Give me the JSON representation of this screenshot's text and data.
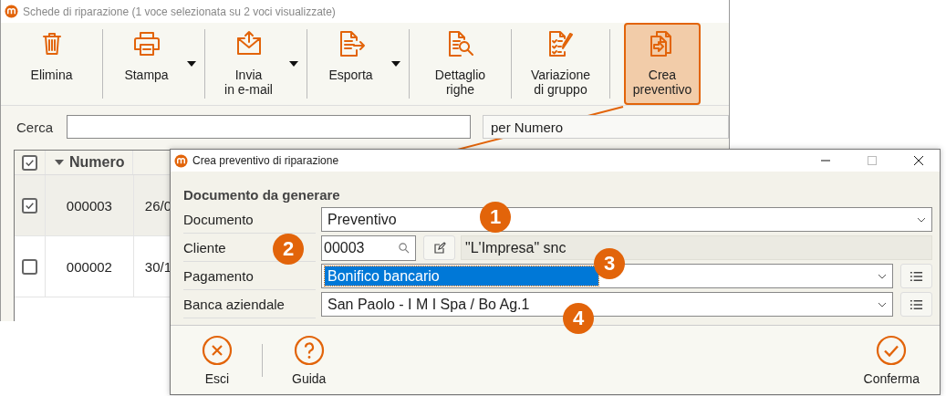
{
  "main_window": {
    "title": "Schede di riparazione (1 voce selezionata su 2 voci visualizzate)",
    "toolbar": [
      {
        "kind": "trash",
        "label": "Elimina",
        "dropdown": false,
        "selected": false
      },
      {
        "kind": "printer",
        "label": "Stampa",
        "dropdown": true,
        "selected": false
      },
      {
        "kind": "mail",
        "label": "Invia\nin e-mail",
        "dropdown": true,
        "selected": false
      },
      {
        "kind": "export",
        "label": "Esporta",
        "dropdown": true,
        "selected": false
      },
      {
        "kind": "detail",
        "label": "Dettaglio\nrighe",
        "dropdown": false,
        "selected": false
      },
      {
        "kind": "checklist",
        "label": "Variazione\ndi gruppo",
        "dropdown": false,
        "selected": false
      },
      {
        "kind": "copy",
        "label": "Crea\npreventivo",
        "dropdown": false,
        "selected": true
      }
    ],
    "search": {
      "label": "Cerca"
    },
    "sort_select": "per Numero",
    "table": {
      "header_checked": true,
      "columns": [
        "Numero"
      ],
      "rows": [
        {
          "checked": true,
          "selected": true,
          "cells": [
            "000003",
            "26/0"
          ]
        },
        {
          "checked": false,
          "selected": false,
          "cells": [
            "000002",
            "30/1"
          ]
        }
      ]
    }
  },
  "dialog": {
    "title": "Crea preventivo di riparazione",
    "section": "Documento da generare",
    "fields": [
      {
        "kind": "select",
        "label": "Documento",
        "value": "Preventivo",
        "selected": false,
        "list_button": false
      },
      {
        "kind": "lookup",
        "label": "Cliente",
        "value": "00003",
        "description": "\"L'Impresa\" snc"
      },
      {
        "kind": "select",
        "label": "Pagamento",
        "value": "Bonifico bancario",
        "selected": true,
        "list_button": true
      },
      {
        "kind": "select",
        "label": "Banca aziendale",
        "value": "San Paolo - I M I Spa / Bo Ag.1",
        "selected": false,
        "list_button": true
      }
    ],
    "buttons": [
      {
        "kind": "close",
        "label": "Esci"
      },
      {
        "kind": "help",
        "label": "Guida"
      },
      {
        "kind": "confirm",
        "label": "Conferma"
      }
    ]
  },
  "callouts": [
    "1",
    "2",
    "3",
    "4"
  ]
}
